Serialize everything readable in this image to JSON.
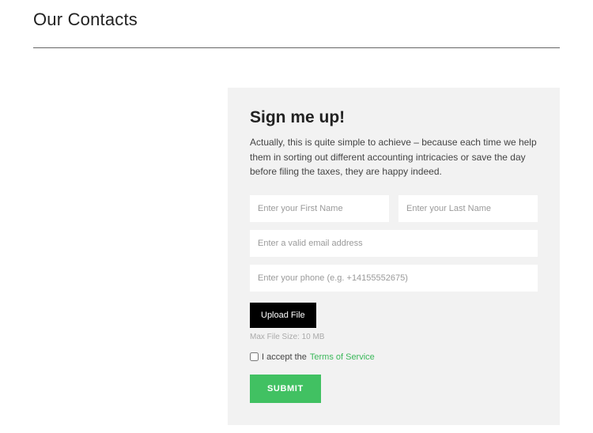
{
  "page": {
    "title": "Our Contacts"
  },
  "form": {
    "heading": "Sign me up!",
    "description": "Actually, this is quite simple to achieve – because each time we help them in sorting out different accounting intricacies or save the day before filing the taxes, they are happy indeed.",
    "first_name_placeholder": "Enter your First Name",
    "last_name_placeholder": "Enter your Last Name",
    "email_placeholder": "Enter a valid email address",
    "phone_placeholder": "Enter your phone (e.g. +14155552675)",
    "upload_label": "Upload File",
    "upload_hint": "Max File Size: 10 MB",
    "accept_prefix": "I accept the ",
    "tos_link": "Terms of Service",
    "submit_label": "SUBMIT"
  }
}
